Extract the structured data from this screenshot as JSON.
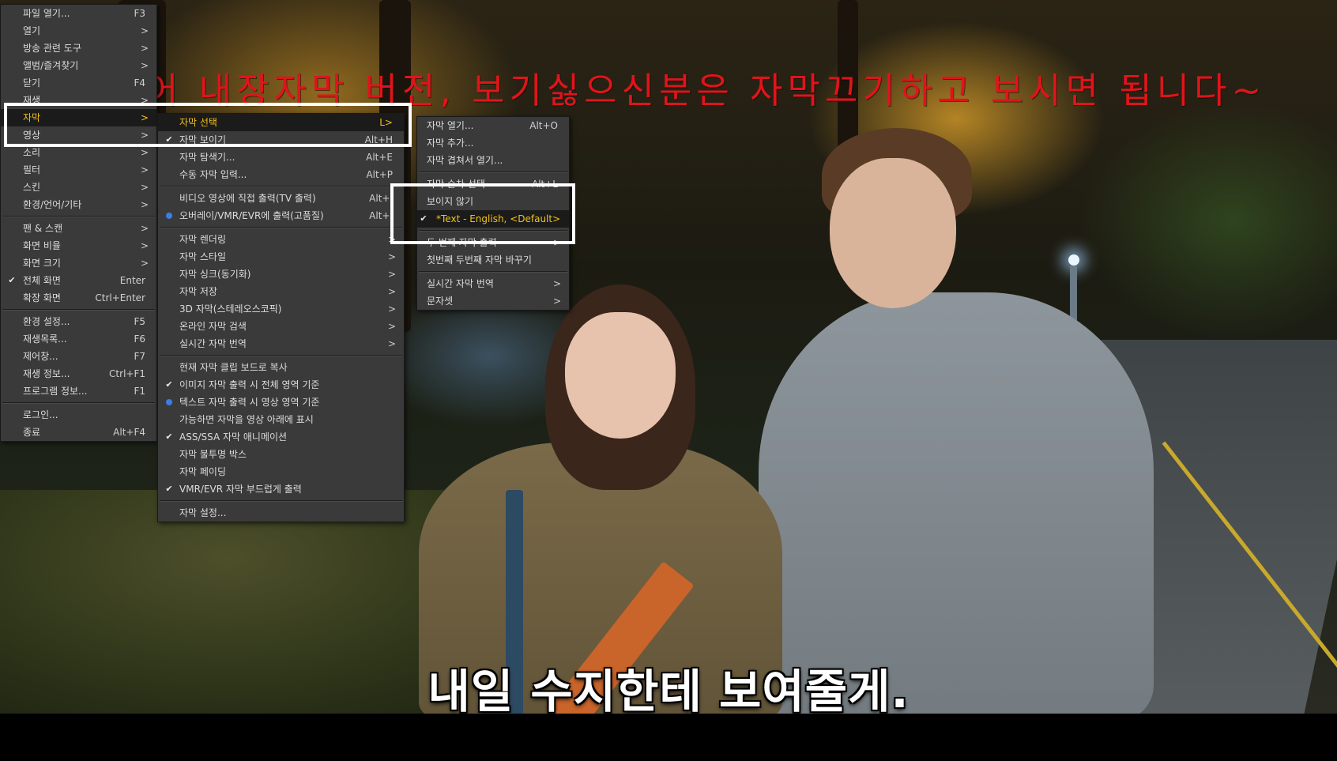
{
  "main_menu": [
    {
      "label": "파일 열기...",
      "shortcut": "F3"
    },
    {
      "label": "열기",
      "arrow": ">"
    },
    {
      "label": "방송 관련 도구",
      "arrow": ">"
    },
    {
      "label": "앨범/즐겨찾기",
      "arrow": ">"
    },
    {
      "label": "닫기",
      "shortcut": "F4"
    },
    {
      "label": "재생",
      "arrow": ">"
    },
    {
      "label": "자막",
      "arrow": ">",
      "highlighted": true
    },
    {
      "label": "영상",
      "arrow": ">"
    },
    {
      "label": "소리",
      "arrow": ">"
    },
    {
      "label": "필터",
      "arrow": ">"
    },
    {
      "label": "스킨",
      "arrow": ">"
    },
    {
      "label": "환경/언어/기타",
      "arrow": ">"
    },
    {
      "label": "팬 & 스캔",
      "arrow": ">"
    },
    {
      "label": "화면 비율",
      "arrow": ">"
    },
    {
      "label": "화면 크기",
      "arrow": ">"
    },
    {
      "label": "전체 화면",
      "shortcut": "Enter",
      "checked": true
    },
    {
      "label": "확장 화면",
      "shortcut": "Ctrl+Enter"
    },
    {
      "label": "환경 설정...",
      "shortcut": "F5"
    },
    {
      "label": "재생목록...",
      "shortcut": "F6"
    },
    {
      "label": "제어창...",
      "shortcut": "F7"
    },
    {
      "label": "재생 정보...",
      "shortcut": "Ctrl+F1"
    },
    {
      "label": "프로그램 정보...",
      "shortcut": "F1"
    },
    {
      "label": "로그인..."
    },
    {
      "label": "종료",
      "shortcut": "Alt+F4"
    }
  ],
  "subtitle_menu": [
    {
      "label": "자막 선택",
      "shortcut": "L>",
      "highlighted": true
    },
    {
      "label": "자막 보이기",
      "shortcut": "Alt+H",
      "checked": true
    },
    {
      "label": "자막 탐색기...",
      "shortcut": "Alt+E"
    },
    {
      "label": "수동 자막 입력...",
      "shortcut": "Alt+P"
    },
    {
      "label": "비디오 영상에 직접 출력(TV 출력)",
      "shortcut": "Alt+I"
    },
    {
      "label": "오버레이/VMR/EVR에 출력(고품질)",
      "shortcut": "Alt+I",
      "radio": true
    },
    {
      "label": "자막 렌더링",
      "arrow": ">"
    },
    {
      "label": "자막 스타일",
      "arrow": ">"
    },
    {
      "label": "자막 싱크(동기화)",
      "arrow": ">"
    },
    {
      "label": "자막 저장",
      "arrow": ">"
    },
    {
      "label": "3D 자막(스테레오스코픽)",
      "arrow": ">"
    },
    {
      "label": "온라인 자막 검색",
      "arrow": ">"
    },
    {
      "label": "실시간 자막 번역",
      "arrow": ">"
    },
    {
      "label": "현재 자막 클립 보드로 복사"
    },
    {
      "label": "이미지 자막 출력 시 전체 영역 기준",
      "checked": true
    },
    {
      "label": "텍스트 자막 출력 시 영상 영역 기준",
      "radio": true
    },
    {
      "label": "가능하면 자막을 영상 아래에 표시"
    },
    {
      "label": "ASS/SSA 자막 애니메이션",
      "checked": true
    },
    {
      "label": "자막 불투명 박스"
    },
    {
      "label": "자막 페이딩"
    },
    {
      "label": "VMR/EVR 자막 부드럽게 출력",
      "checked": true
    },
    {
      "label": "자막 설정..."
    }
  ],
  "subtitle_select_menu": [
    {
      "label": "자막 열기...",
      "shortcut": "Alt+O"
    },
    {
      "label": "자막 추가..."
    },
    {
      "label": "자막 겹쳐서 열기..."
    },
    {
      "label": "자막 순차 선택",
      "shortcut": "Alt+L"
    },
    {
      "label": "보이지 않기"
    },
    {
      "label": "*Text - English, <Default>",
      "checked": true,
      "highlighted": true
    },
    {
      "label": "두 번째 자막 출력",
      "arrow": ">"
    },
    {
      "label": "첫번째 두번째 자막 바꾸기"
    },
    {
      "label": "실시간 자막 번역",
      "arrow": ">"
    },
    {
      "label": "문자셋",
      "arrow": ">"
    }
  ],
  "overlay": {
    "banner": "★ 영어 내장자막 버전, 보기싫으신분은 자막끄기하고 보시면 됩니다~",
    "subtitle": "내일 수지한테 보여줄게."
  },
  "icons": {
    "check": "✔"
  },
  "colors": {
    "highlight_text": "#f2c21b",
    "banner": "#e0141a",
    "menu_bg": "#3a3a3a",
    "radio": "#3b7ee6"
  }
}
